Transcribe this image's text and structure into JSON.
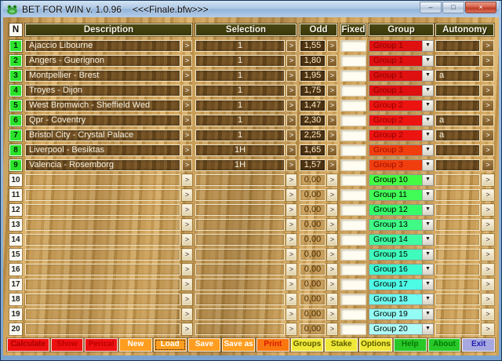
{
  "window": {
    "title": "BET FOR WIN v. 1.0.96",
    "file_label": "<<<Finale.bfw>>>"
  },
  "icons": {
    "app": "frog-icon",
    "minimize": "–",
    "maximize": "□",
    "close": "×",
    "row_button": ">",
    "dropdown_arrow": "▼"
  },
  "table": {
    "headers": {
      "n": "N",
      "description": "Description",
      "selection": "Selection",
      "odd": "Odd",
      "fixed": "Fixed",
      "group": "Group",
      "autonomy": "Autonomy"
    },
    "rows": [
      {
        "n": "1",
        "description": "Ajaccio Libourne",
        "selection": "1",
        "odd": "1,55",
        "fixed": "",
        "group": "Group 1",
        "group_bg": "#de1010",
        "group_fg": "#8d0000",
        "autonomy": ""
      },
      {
        "n": "2",
        "description": "Angers - Guerignon",
        "selection": "1",
        "odd": "1,80",
        "fixed": "",
        "group": "Group 1",
        "group_bg": "#de1010",
        "group_fg": "#8d0000",
        "autonomy": ""
      },
      {
        "n": "3",
        "description": "Montpellier - Brest",
        "selection": "1",
        "odd": "1,95",
        "fixed": "",
        "group": "Group 1",
        "group_bg": "#de1010",
        "group_fg": "#8d0000",
        "autonomy": "a"
      },
      {
        "n": "4",
        "description": "Troyes - Dijon",
        "selection": "1",
        "odd": "1,75",
        "fixed": "",
        "group": "Group 1",
        "group_bg": "#de1010",
        "group_fg": "#8d0000",
        "autonomy": ""
      },
      {
        "n": "5",
        "description": "West Bromwich - Sheffield Wed",
        "selection": "1",
        "odd": "1,47",
        "fixed": "",
        "group": "Group 2",
        "group_bg": "#ec1410",
        "group_fg": "#8d0000",
        "autonomy": ""
      },
      {
        "n": "6",
        "description": "Qpr - Coventry",
        "selection": "1",
        "odd": "2,30",
        "fixed": "",
        "group": "Group 2",
        "group_bg": "#ec1410",
        "group_fg": "#8d0000",
        "autonomy": "a"
      },
      {
        "n": "7",
        "description": "Bristol City - Crystal Palace",
        "selection": "1",
        "odd": "2,25",
        "fixed": "",
        "group": "Group 2",
        "group_bg": "#ec1410",
        "group_fg": "#8d0000",
        "autonomy": "a"
      },
      {
        "n": "8",
        "description": "Liverpool - Besiktas",
        "selection": "1H",
        "odd": "1,65",
        "fixed": "",
        "group": "Group 3",
        "group_bg": "#f13e0e",
        "group_fg": "#9d0e00",
        "autonomy": ""
      },
      {
        "n": "9",
        "description": "Valencia - Rosemborg",
        "selection": "1H",
        "odd": "1,57",
        "fixed": "",
        "group": "Group 3",
        "group_bg": "#f13e0e",
        "group_fg": "#9d0e00",
        "autonomy": ""
      },
      {
        "n": "10",
        "description": "",
        "selection": "",
        "odd": "0,00",
        "fixed": "",
        "group": "Group 10",
        "group_bg": "#44fb44",
        "group_fg": "#000000",
        "autonomy": ""
      },
      {
        "n": "11",
        "description": "",
        "selection": "",
        "odd": "0,00",
        "fixed": "",
        "group": "Group 11",
        "group_bg": "#41fb57",
        "group_fg": "#000000",
        "autonomy": ""
      },
      {
        "n": "12",
        "description": "",
        "selection": "",
        "odd": "0,00",
        "fixed": "",
        "group": "Group 12",
        "group_bg": "#36fb69",
        "group_fg": "#000000",
        "autonomy": ""
      },
      {
        "n": "13",
        "description": "",
        "selection": "",
        "odd": "0,00",
        "fixed": "",
        "group": "Group 13",
        "group_bg": "#3ffb86",
        "group_fg": "#000000",
        "autonomy": ""
      },
      {
        "n": "14",
        "description": "",
        "selection": "",
        "odd": "0,00",
        "fixed": "",
        "group": "Group 14",
        "group_bg": "#3ffba2",
        "group_fg": "#000000",
        "autonomy": ""
      },
      {
        "n": "15",
        "description": "",
        "selection": "",
        "odd": "0,00",
        "fixed": "",
        "group": "Group 15",
        "group_bg": "#3ffbbc",
        "group_fg": "#000000",
        "autonomy": ""
      },
      {
        "n": "16",
        "description": "",
        "selection": "",
        "odd": "0,00",
        "fixed": "",
        "group": "Group 16",
        "group_bg": "#3ffbd2",
        "group_fg": "#000000",
        "autonomy": ""
      },
      {
        "n": "17",
        "description": "",
        "selection": "",
        "odd": "0,00",
        "fixed": "",
        "group": "Group 17",
        "group_bg": "#4efce6",
        "group_fg": "#000000",
        "autonomy": ""
      },
      {
        "n": "18",
        "description": "",
        "selection": "",
        "odd": "0,00",
        "fixed": "",
        "group": "Group 18",
        "group_bg": "#6ffcf0",
        "group_fg": "#000000",
        "autonomy": ""
      },
      {
        "n": "19",
        "description": "",
        "selection": "",
        "odd": "0,00",
        "fixed": "",
        "group": "Group 19",
        "group_bg": "#93fcf4",
        "group_fg": "#000000",
        "autonomy": ""
      },
      {
        "n": "20",
        "description": "",
        "selection": "",
        "odd": "0,00",
        "fixed": "",
        "group": "Group 20",
        "group_bg": "#aefcf6",
        "group_fg": "#000000",
        "autonomy": ""
      }
    ]
  },
  "toolbar": {
    "buttons": [
      {
        "label": "Calculate",
        "bg": "#ee1111",
        "fg": "#a80000",
        "wide": true,
        "focused": false
      },
      {
        "label": "Show",
        "bg": "#ee1111",
        "fg": "#bb0000",
        "wide": false,
        "focused": false
      },
      {
        "label": "Perical",
        "bg": "#ee1111",
        "fg": "#bb0000",
        "wide": false,
        "focused": false
      },
      {
        "label": "New",
        "bg": "#ff9d20",
        "fg": "#ffffff",
        "wide": false,
        "focused": false
      },
      {
        "label": "Load",
        "bg": "#ff9d20",
        "fg": "#ffffff",
        "wide": false,
        "focused": true
      },
      {
        "label": "Save",
        "bg": "#ff9d20",
        "fg": "#ffffff",
        "wide": false,
        "focused": false
      },
      {
        "label": "Save as",
        "bg": "#ff9d20",
        "fg": "#ffffff",
        "wide": false,
        "focused": false
      },
      {
        "label": "Print",
        "bg": "#f97710",
        "fg": "#d81800",
        "wide": false,
        "focused": false
      },
      {
        "label": "Groups",
        "bg": "#f0e838",
        "fg": "#5a5a00",
        "wide": false,
        "focused": false
      },
      {
        "label": "Stake",
        "bg": "#f0e838",
        "fg": "#5a5a00",
        "wide": false,
        "focused": false
      },
      {
        "label": "Options",
        "bg": "#f0e838",
        "fg": "#5a5a00",
        "wide": false,
        "focused": false
      },
      {
        "label": "Help",
        "bg": "#28c828",
        "fg": "#067806",
        "wide": false,
        "focused": false
      },
      {
        "label": "About",
        "bg": "#28c828",
        "fg": "#067806",
        "wide": false,
        "focused": false
      },
      {
        "label": "Exit",
        "bg": "#a8a8e0",
        "fg": "#2020b0",
        "wide": false,
        "focused": false
      }
    ]
  }
}
